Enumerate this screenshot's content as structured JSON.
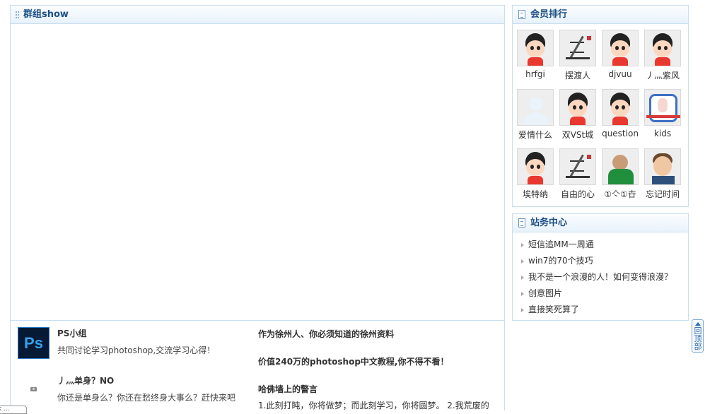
{
  "left_panel": {
    "title": "群组show"
  },
  "groups": [
    {
      "name": "PS小组",
      "desc": "共同讨论学习photoshop,交流学习心得！",
      "logo_text": "Ps",
      "icon": "photoshop-logo"
    },
    {
      "name": "丿灬单身？NO",
      "desc": "你还是单身么？你还在愁终身大事么？赶快来吧",
      "icon": "camera-icon"
    }
  ],
  "articles": [
    {
      "title": "作为徐州人、你必须知道的徐州资料"
    },
    {
      "title": "价值240万的photoshop中文教程,你不得不看！"
    },
    {
      "title": "哈佛墙上的警言"
    },
    {
      "excerpt": "1.此刻打盹，你将做梦；而此刻学习，你将圆梦。 2.我荒废的"
    }
  ],
  "members_panel": {
    "title": "会员排行",
    "members": [
      {
        "name": "hrfgi",
        "avatar": "cartoon"
      },
      {
        "name": "摆渡人",
        "avatar": "ink"
      },
      {
        "name": "djvuu",
        "avatar": "cartoon"
      },
      {
        "name": "丿灬紫风",
        "avatar": "cartoon"
      },
      {
        "name": "爱情什么",
        "avatar": "blank"
      },
      {
        "name": "双VSt城",
        "avatar": "cartoon"
      },
      {
        "name": "question",
        "avatar": "cartoon"
      },
      {
        "name": "kids",
        "avatar": "anime"
      },
      {
        "name": "埃特纳",
        "avatar": "cartoon"
      },
      {
        "name": "自由的心",
        "avatar": "ink"
      },
      {
        "name": "①亽①卋",
        "avatar": "photo1"
      },
      {
        "name": "忘记时间",
        "avatar": "photo2"
      }
    ]
  },
  "station_panel": {
    "title": "站务中心",
    "items": [
      "短信追MM一周通",
      "win7的70个技巧",
      "我不是一个浪漫的人！如何变得浪漫？",
      "创意图片",
      "直接笑死算了"
    ]
  },
  "back_top": {
    "label": "回顶部"
  },
  "corner_tab": {
    "label": "k ..."
  }
}
